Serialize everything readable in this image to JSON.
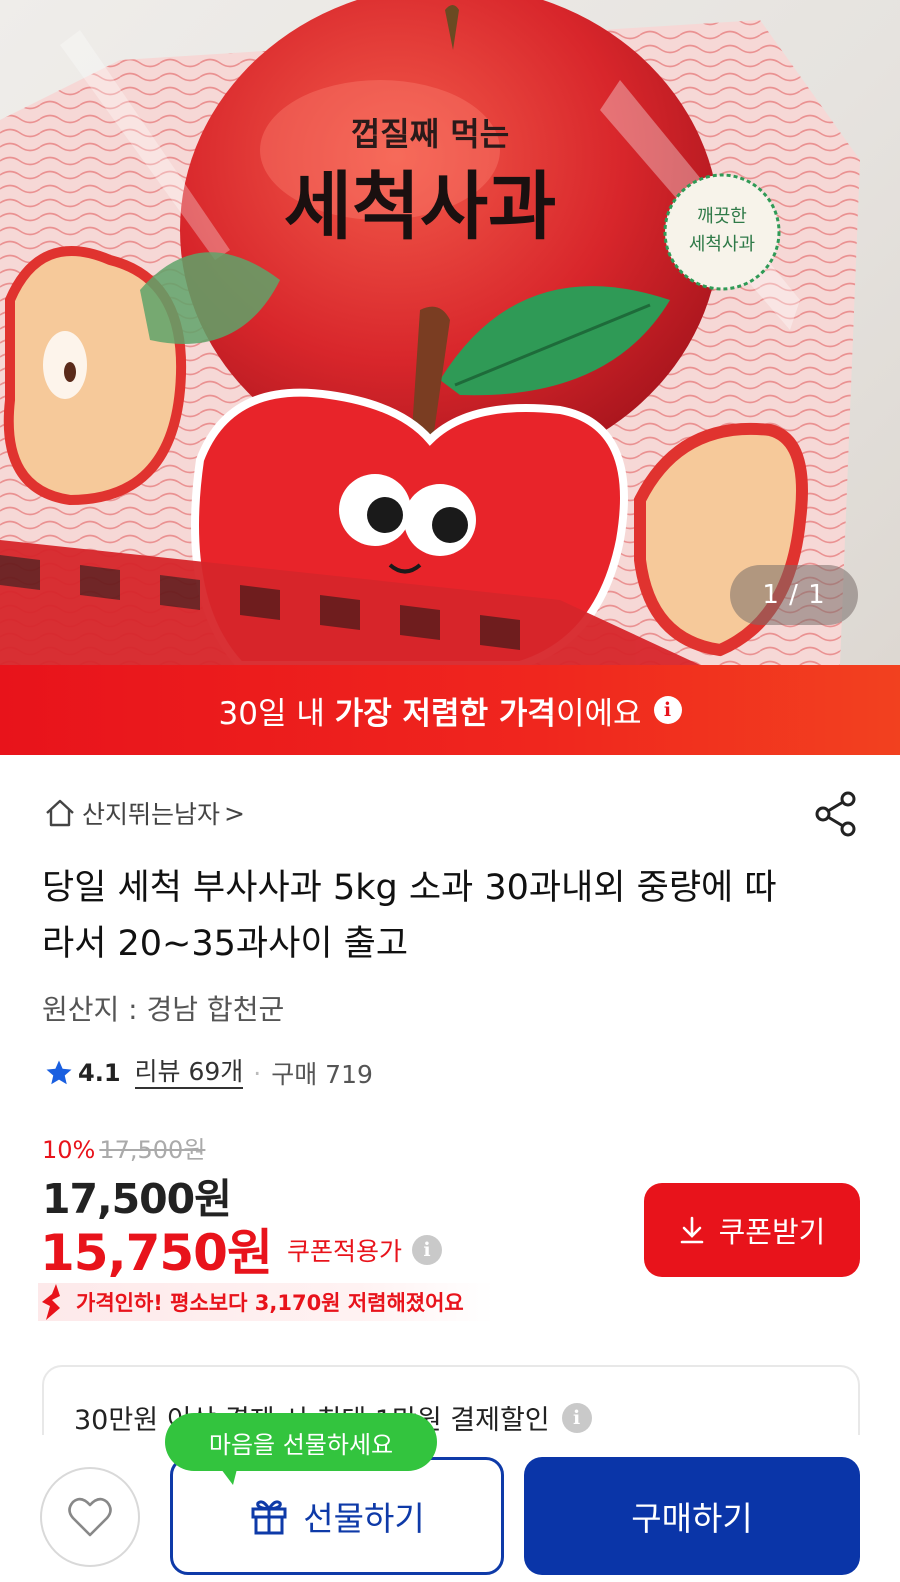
{
  "image": {
    "counter": "1 / 1",
    "package_small_text": "껍질째 먹는",
    "package_big_text": "세척사과",
    "badge_line1": "깨끗한",
    "badge_line2": "세척사과"
  },
  "banner": {
    "pre": "30일 내 ",
    "bold": "가장 저렴한 가격",
    "post": "이에요",
    "icon": "info-icon"
  },
  "seller": {
    "name": "산지뛰는남자",
    "chevron": ">",
    "icon": "home-icon"
  },
  "share_icon": "share-icon",
  "product": {
    "title": "당일 세척 부사사과 5kg 소과 30과내외 중량에 따라서 20~35과사이 출고",
    "origin": "원산지 : 경남 합천군"
  },
  "rating": {
    "score": "4.1",
    "reviews": "리뷰 69개",
    "separator": "·",
    "purchases": "구매 719"
  },
  "price": {
    "discount_rate": "10%",
    "original_strike": "17,500원",
    "main": "17,500원",
    "coupon_price": "15,750원",
    "coupon_label": "쿠폰적용가",
    "drop_text": "가격인하! 평소보다 3,170원 저렴해졌어요",
    "coupon_button": "쿠폰받기"
  },
  "card": {
    "text": "30만원 이상 결제 시 최대 1만원 결제할인"
  },
  "bottom": {
    "tooltip": "마음을 선물하세요",
    "gift_button": "선물하기",
    "buy_button": "구매하기"
  },
  "colors": {
    "accent_red": "#e8131b",
    "brand_blue": "#0a35a8",
    "tooltip_green": "#33c43e"
  }
}
